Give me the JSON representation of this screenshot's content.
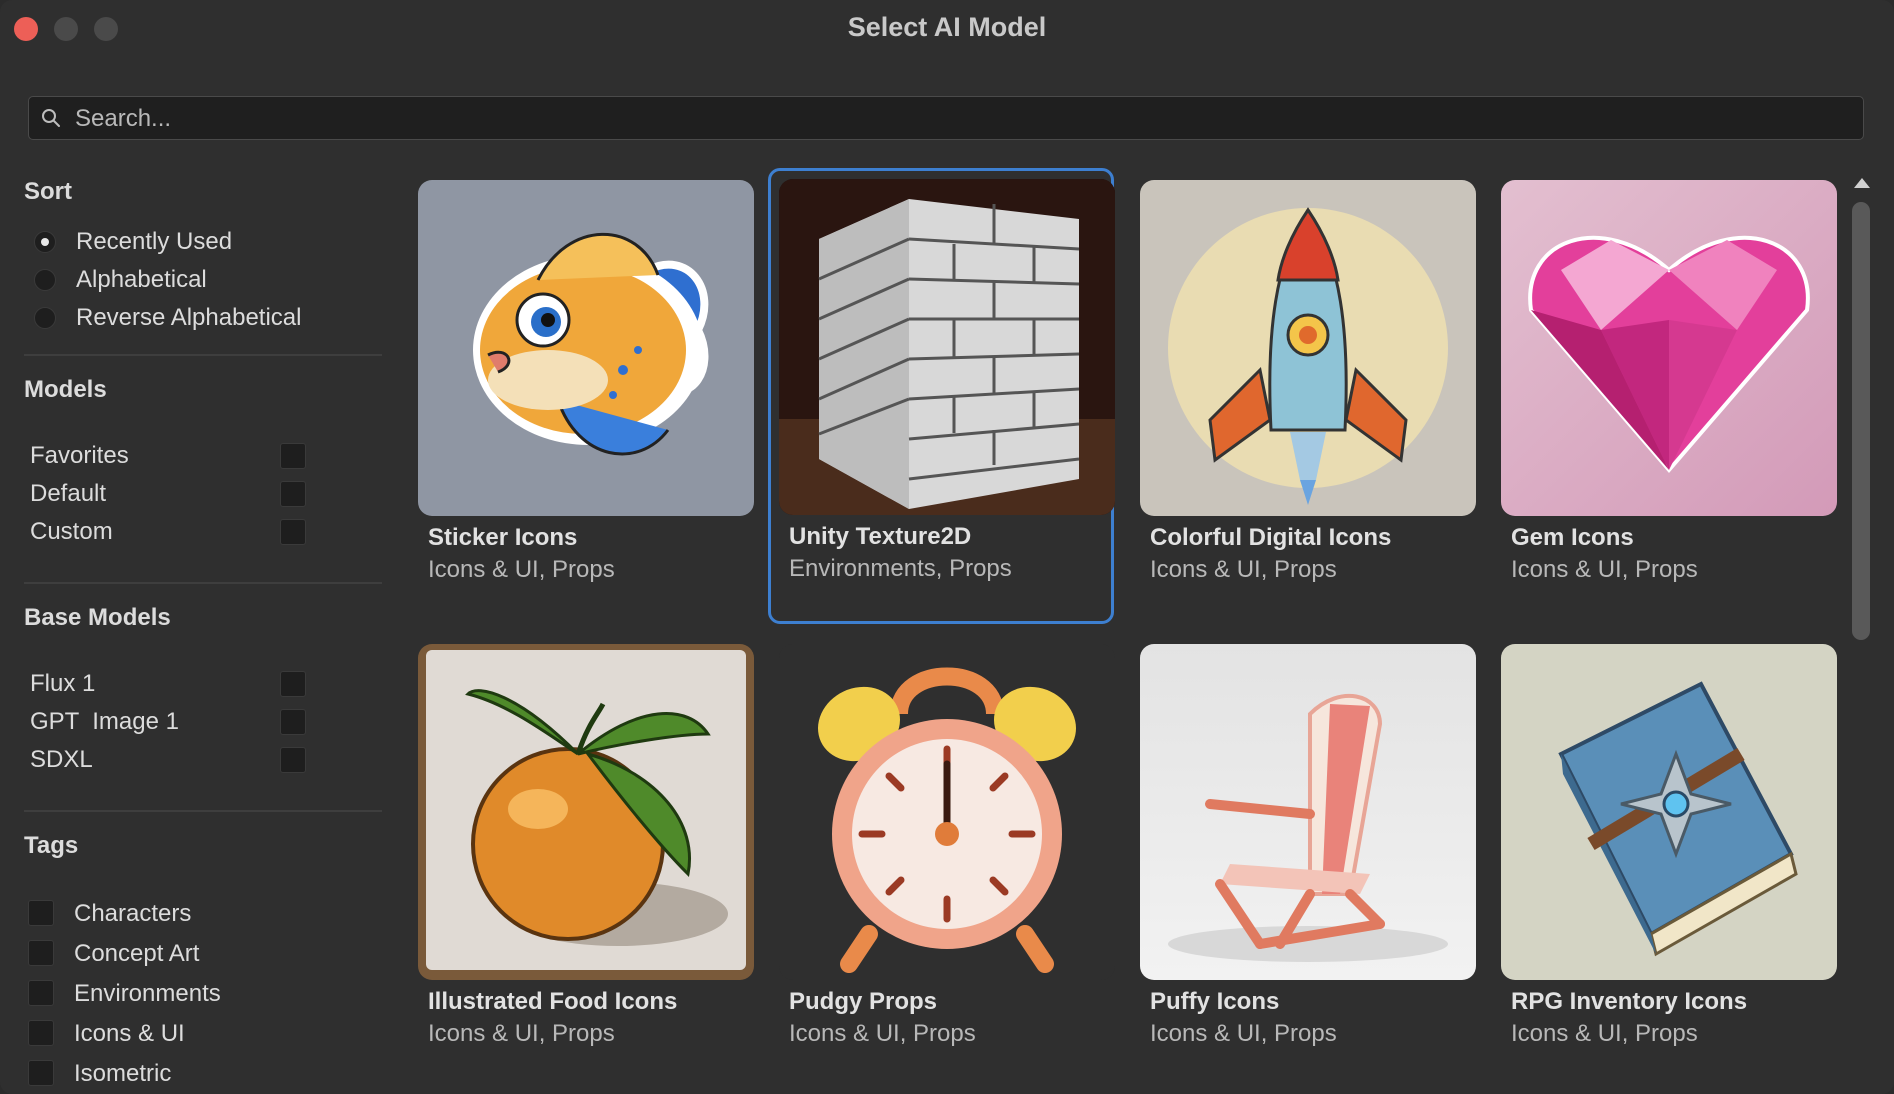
{
  "window": {
    "title": "Select AI Model"
  },
  "search": {
    "placeholder": "Search..."
  },
  "sort": {
    "title": "Sort",
    "options": [
      {
        "label": "Recently Used",
        "selected": true
      },
      {
        "label": "Alphabetical",
        "selected": false
      },
      {
        "label": "Reverse Alphabetical",
        "selected": false
      }
    ]
  },
  "models": {
    "title": "Models",
    "items": [
      {
        "label": "Favorites",
        "checked": false
      },
      {
        "label": "Default",
        "checked": false
      },
      {
        "label": "Custom",
        "checked": false
      }
    ]
  },
  "base_models": {
    "title": "Base Models",
    "items": [
      {
        "label": "Flux 1",
        "checked": false
      },
      {
        "label": "GPT  Image 1",
        "checked": false
      },
      {
        "label": "SDXL",
        "checked": false
      }
    ]
  },
  "tags": {
    "title": "Tags",
    "items": [
      {
        "label": "Characters",
        "checked": false
      },
      {
        "label": "Concept Art",
        "checked": false
      },
      {
        "label": "Environments",
        "checked": false
      },
      {
        "label": "Icons & UI",
        "checked": false
      },
      {
        "label": "Isometric",
        "checked": false
      }
    ]
  },
  "cards": [
    {
      "title": "Sticker Icons",
      "tags": "Icons & UI, Props",
      "image": "fish-sticker-icon",
      "selected": false
    },
    {
      "title": "Unity Texture2D",
      "tags": "Environments, Props",
      "image": "brick-cube-icon",
      "selected": true
    },
    {
      "title": "Colorful Digital Icons",
      "tags": "Icons & UI, Props",
      "image": "rocket-icon",
      "selected": false
    },
    {
      "title": "Gem Icons",
      "tags": "Icons & UI, Props",
      "image": "heart-gem-icon",
      "selected": false
    },
    {
      "title": "Illustrated Food Icons",
      "tags": "Icons & UI, Props",
      "image": "orange-icon",
      "selected": false
    },
    {
      "title": "Pudgy Props",
      "tags": "Icons & UI, Props",
      "image": "alarm-clock-icon",
      "selected": false
    },
    {
      "title": "Puffy Icons",
      "tags": "Icons & UI, Props",
      "image": "beach-chair-icon",
      "selected": false
    },
    {
      "title": "RPG Inventory Icons",
      "tags": "Icons & UI, Props",
      "image": "spell-book-icon",
      "selected": false
    }
  ],
  "colors": {
    "accent": "#3d7fd0",
    "close": "#ed5f57"
  }
}
